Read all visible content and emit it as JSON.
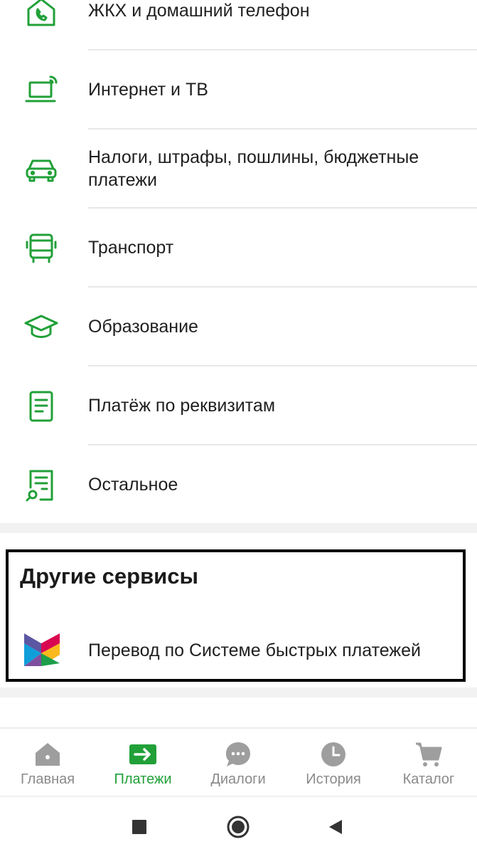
{
  "colors": {
    "accent": "#21a038",
    "inactive": "#9e9e9e",
    "text": "#1f1f1f"
  },
  "categories": [
    {
      "icon": "house-phone-icon",
      "label": "ЖКХ и домашний телефон"
    },
    {
      "icon": "laptop-wifi-icon",
      "label": "Интернет и ТВ"
    },
    {
      "icon": "car-icon",
      "label": "Налоги, штрафы, пошлины, бюджетные платежи"
    },
    {
      "icon": "bus-icon",
      "label": "Транспорт"
    },
    {
      "icon": "graduation-cap-icon",
      "label": "Образование"
    },
    {
      "icon": "document-icon",
      "label": "Платёж по реквизитам"
    },
    {
      "icon": "document-search-icon",
      "label": "Остальное"
    }
  ],
  "other_services": {
    "title": "Другие сервисы",
    "item": {
      "icon": "sbp-logo-icon",
      "label": "Перевод по Системе быстрых платежей"
    }
  },
  "bottom_nav": [
    {
      "icon": "home-icon",
      "label": "Главная",
      "active": false
    },
    {
      "icon": "payments-arrow-icon",
      "label": "Платежи",
      "active": true
    },
    {
      "icon": "chat-bubble-icon",
      "label": "Диалоги",
      "active": false
    },
    {
      "icon": "clock-icon",
      "label": "История",
      "active": false
    },
    {
      "icon": "cart-icon",
      "label": "Каталог",
      "active": false
    }
  ],
  "system_bar": [
    {
      "icon": "recent-apps-icon"
    },
    {
      "icon": "home-circle-icon"
    },
    {
      "icon": "back-triangle-icon"
    }
  ]
}
